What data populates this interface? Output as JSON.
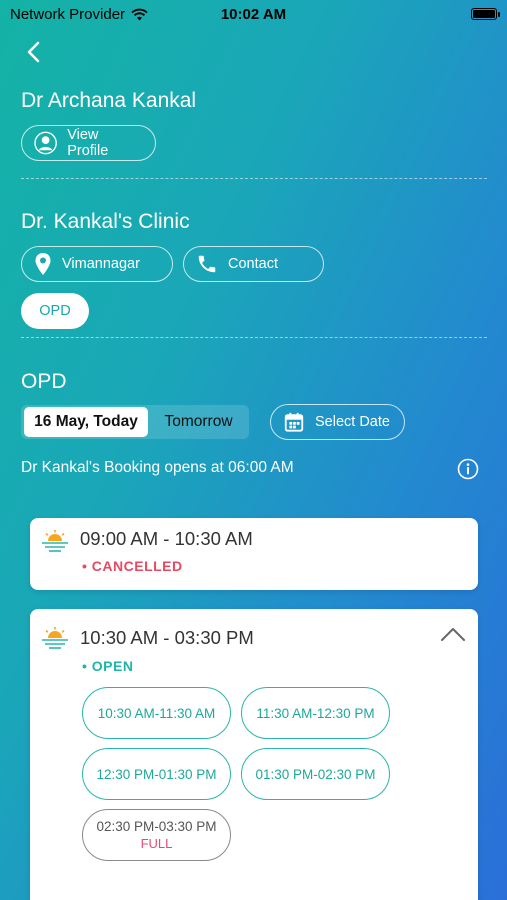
{
  "status_bar": {
    "carrier": "Network Provider",
    "time": "10:02 AM"
  },
  "doctor": {
    "name": "Dr Archana Kankal",
    "view_profile_label": "View Profile"
  },
  "clinic": {
    "name": "Dr. Kankal's Clinic",
    "location_label": "Vimannagar",
    "contact_label": "Contact",
    "service_chip": "OPD"
  },
  "opd": {
    "title": "OPD",
    "tabs": [
      {
        "label": "16 May, Today",
        "active": true
      },
      {
        "label": "Tomorrow",
        "active": false
      }
    ],
    "select_date_label": "Select Date",
    "booking_note": "Dr Kankal's Booking opens at 06:00 AM"
  },
  "sessions": [
    {
      "time": "09:00 AM - 10:30 AM",
      "status": "CANCELLED"
    },
    {
      "time": "10:30 AM - 03:30 PM",
      "status": "OPEN",
      "slots": [
        {
          "label": "10:30 AM-11:30 AM"
        },
        {
          "label": "11:30 AM-12:30 PM"
        },
        {
          "label": "12:30 PM-01:30 PM"
        },
        {
          "label": "01:30 PM-02:30 PM"
        },
        {
          "label": "02:30 PM-03:30 PM",
          "badge": "FULL"
        }
      ]
    }
  ],
  "colors": {
    "accent": "#1fb5a8",
    "cancel": "#e64a62",
    "full": "#e64a72",
    "gradient_start": "#14b3a5",
    "gradient_end": "#2a6fd8"
  },
  "icons": [
    "back-icon",
    "wifi-icon",
    "battery-icon",
    "user-icon",
    "location-pin-icon",
    "phone-icon",
    "calendar-icon",
    "info-icon",
    "sunrise-icon",
    "chevron-up-icon"
  ]
}
